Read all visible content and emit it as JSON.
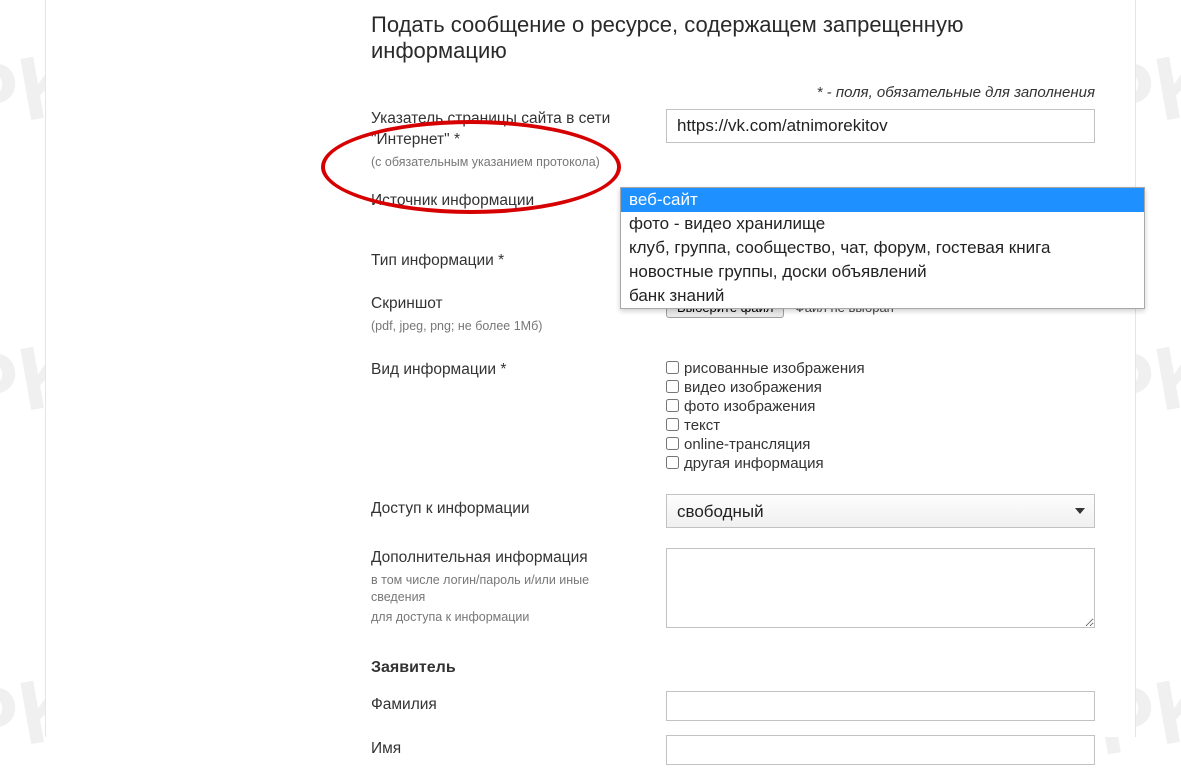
{
  "page_title": "Подать сообщение о ресурсе, содержащем запрещенную информацию",
  "required_note": "* - поля, обязательные для заполнения",
  "url_field": {
    "label": "Указатель страницы сайта в сети \"Интернет\" *",
    "hint": "(с обязательным указанием протокола)",
    "value": "https://vk.com/atnimorekitov"
  },
  "source_field": {
    "label": "Источник информации",
    "selected": "веб-сайт",
    "options": [
      "веб-сайт",
      "фото - видео хранилище",
      "клуб, группа, сообщество, чат, форум, гостевая книга",
      "новостные группы, доски объявлений",
      "банк знаний"
    ]
  },
  "type_field": {
    "label": "Тип информации *"
  },
  "screenshot_field": {
    "label": "Скриншот",
    "hint": "(pdf, jpeg, png; не более 1Мб)",
    "button": "Выберите файл",
    "status": "Файл не выбран"
  },
  "kind_field": {
    "label": "Вид информации *",
    "options": [
      "рисованные изображения",
      "видео изображения",
      "фото изображения",
      "текст",
      "online-трансляция",
      "другая информация"
    ]
  },
  "access_field": {
    "label": "Доступ к информации",
    "selected": "свободный"
  },
  "additional_field": {
    "label": "Дополнительная информация",
    "hint1": "в том числе логин/пароль и/или иные сведения",
    "hint2": "для доступа к информации"
  },
  "applicant": {
    "heading": "Заявитель",
    "surname_label": "Фамилия",
    "name_label": "Имя"
  }
}
